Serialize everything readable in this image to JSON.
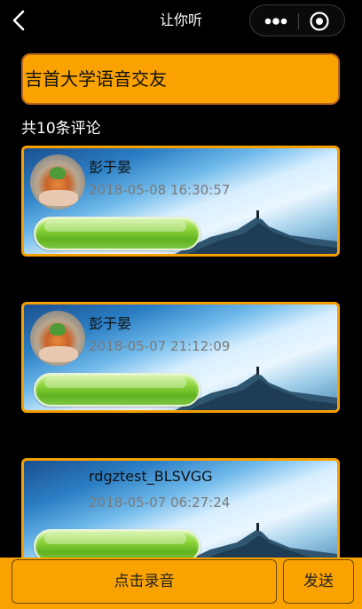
{
  "navbar": {
    "title": "让你听",
    "back_icon": "chevron-left-icon",
    "more_icon": "more-dots-icon",
    "close_icon": "target-circle-icon"
  },
  "header": {
    "text": "吉首大学语音交友"
  },
  "comments_count_text": "共10条评论",
  "comments": [
    {
      "username": "彭于晏",
      "time": "2018-05-08 16:30:57",
      "has_avatar": true
    },
    {
      "username": "彭于晏",
      "time": "2018-05-07 21:12:09",
      "has_avatar": true
    },
    {
      "username": "rdgztest_BLSVGG",
      "time": "2018-05-07 06:27:24",
      "has_avatar": false
    }
  ],
  "bottom_bar": {
    "record_label": "点击录音",
    "send_label": "发送"
  },
  "colors": {
    "accent": "#f9a200",
    "card_border": "#f5a000",
    "play_green": "#61b321",
    "background": "#000000"
  }
}
